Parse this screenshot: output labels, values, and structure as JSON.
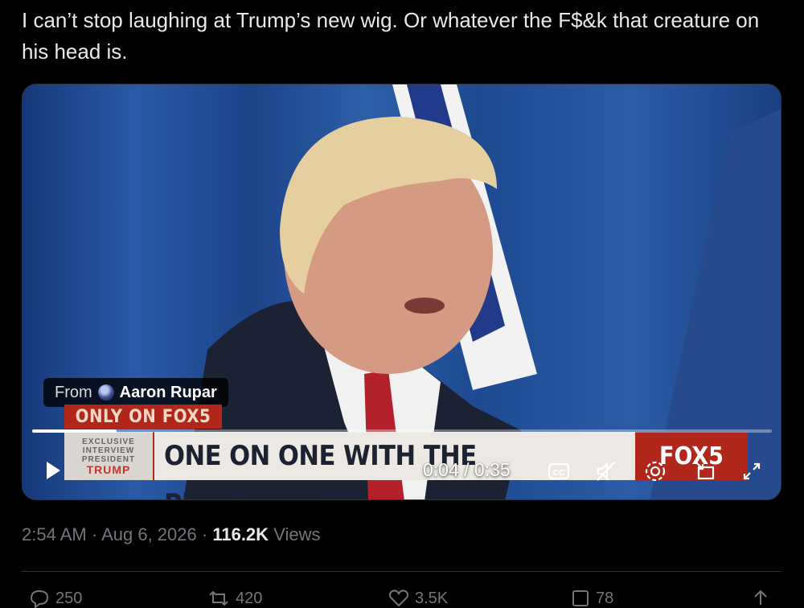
{
  "tweet": {
    "text": "I can’t stop laughing at Trump’s new wig. Or whatever the F$&k that creature on his head is."
  },
  "video": {
    "from_label": "From",
    "author": "Aaron Rupar",
    "banner_tag": "ONLY ON FOX5",
    "lower_third_line1": "EXCLUSIVE",
    "lower_third_line2": "INTERVIEW",
    "lower_third_line3": "PRESIDENT",
    "lower_third_line4": "TRUMP",
    "headline": "ONE ON ONE WITH THE PRESIDENT",
    "station_logo": "FOX5",
    "current_time": "0:04",
    "duration": "0:35",
    "timecode": "0:04 / 0:35",
    "progress_fraction": 0.114,
    "controls": [
      "play-icon",
      "closed-captions-icon",
      "mute-icon",
      "settings-icon",
      "picture-in-picture-icon",
      "fullscreen-icon"
    ]
  },
  "meta": {
    "time": "2:54 AM",
    "sep1": "·",
    "date": "Aug 6, 2026",
    "sep2": "·",
    "views_count": "116.2K",
    "views_label": "Views"
  },
  "actions": {
    "replies": "250",
    "reposts": "420",
    "likes": "3.5K",
    "bookmarks": "78"
  }
}
